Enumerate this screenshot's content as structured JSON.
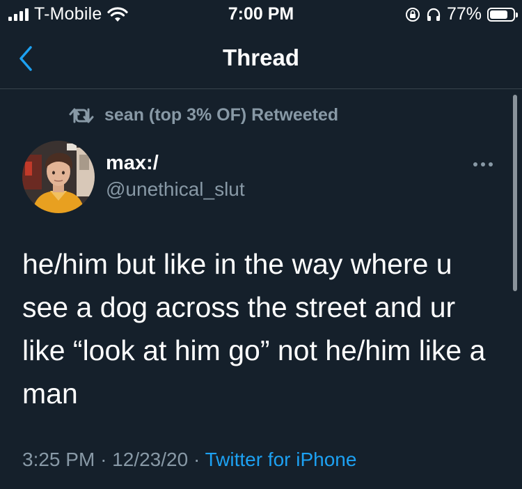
{
  "status_bar": {
    "carrier": "T-Mobile",
    "time": "7:00 PM",
    "battery_percent": "77%",
    "battery_level": 0.77,
    "icons": [
      "signal-icon",
      "wifi-icon",
      "orientation-lock-icon",
      "headphones-icon",
      "battery-icon"
    ]
  },
  "header": {
    "title": "Thread",
    "back_icon": "chevron-left-icon"
  },
  "tweet": {
    "retweet_label": "sean (top 3% OF) Retweeted",
    "author_name": "max:/",
    "author_handle": "@unethical_slut",
    "text": "he/him but like in the way where u\nsee a dog across the street and ur\nlike “look at him go” not he/him like a\nman",
    "time": "3:25 PM",
    "separator": "·",
    "date": "12/23/20",
    "source": "Twitter for iPhone"
  },
  "colors": {
    "background": "#15202b",
    "secondary_text": "#8899a6",
    "accent": "#1da1f2",
    "divider": "#38444d"
  }
}
